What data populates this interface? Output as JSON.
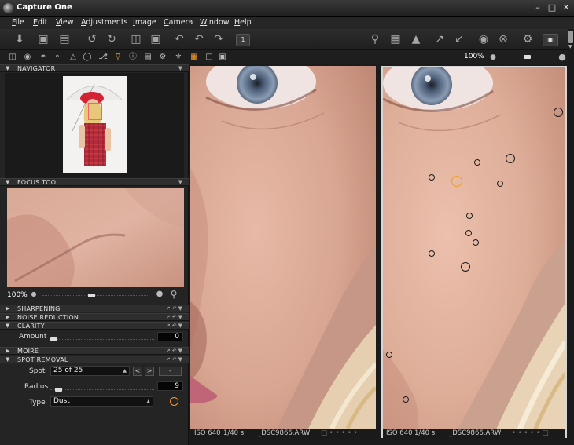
{
  "window": {
    "title": "Capture One"
  },
  "menu": [
    "File",
    "Edit",
    "View",
    "Adjustments",
    "Image",
    "Camera",
    "Window",
    "Help"
  ],
  "toolbar": {
    "icons": [
      "import-icon",
      "fit-icon",
      "compare-icon",
      "rotate-left-icon",
      "rotate-right-icon",
      "folder-icon",
      "trash-icon",
      "undo-all-icon",
      "undo-icon",
      "redo-icon",
      "single-view-icon",
      "loupe-icon",
      "grid-icon",
      "warning-icon",
      "cursor-icon",
      "pick-icon",
      "camera-icon",
      "cancel-icon",
      "settings-icon",
      "capture-icon"
    ],
    "single_view_label": "1"
  },
  "tool_row": {
    "zoom": "100%"
  },
  "panels": {
    "navigator": {
      "title": "NAVIGATOR"
    },
    "focus_tool": {
      "title": "FOCUS TOOL",
      "zoom": "100%"
    },
    "sharpening": {
      "title": "SHARPENING"
    },
    "noise_reduction": {
      "title": "NOISE REDUCTION"
    },
    "clarity": {
      "title": "CLARITY",
      "amount_label": "Amount",
      "amount_value": "0",
      "amount_fraction": 0
    },
    "moire": {
      "title": "MOIRE"
    },
    "spot_removal": {
      "title": "SPOT REMOVAL",
      "spot_label": "Spot",
      "spot_value": "25 of 25",
      "prev": "<",
      "next": ">",
      "remove": "-",
      "radius_label": "Radius",
      "radius_value": "9",
      "radius_fraction": 0.05,
      "type_label": "Type",
      "type_value": "Dust"
    }
  },
  "viewers": [
    {
      "iso": "ISO 640",
      "shutter": "1/40 s",
      "file": "_DSC9866.ARW"
    },
    {
      "iso": "ISO 640",
      "shutter": "1/40 s",
      "file": "_DSC9866.ARW"
    }
  ],
  "colors": {
    "accent": "#f39a2a",
    "panel": "#242424",
    "background": "#1b1b1b"
  }
}
